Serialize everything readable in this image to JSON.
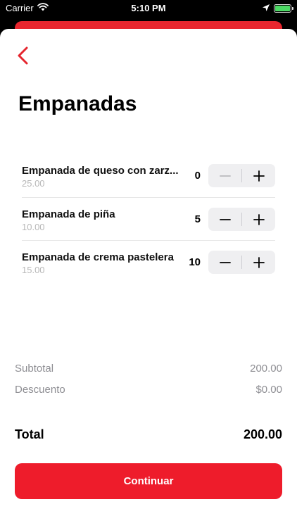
{
  "status_bar": {
    "carrier": "Carrier",
    "time": "5:10 PM",
    "battery_color": "#4cd964"
  },
  "accent_color": "#ee1c2b",
  "header": {
    "back_icon": "chevron-left-icon",
    "title": "Empanadas"
  },
  "items": [
    {
      "name": "Empanada de queso con zarz...",
      "price": "25.00",
      "quantity": "0",
      "minus_enabled": false
    },
    {
      "name": "Empanada de piña",
      "price": "10.00",
      "quantity": "5",
      "minus_enabled": true
    },
    {
      "name": "Empanada de crema pastelera",
      "price": "15.00",
      "quantity": "10",
      "minus_enabled": true
    }
  ],
  "summary": {
    "subtotal_label": "Subtotal",
    "subtotal_value": "200.00",
    "discount_label": "Descuento",
    "discount_value": "$0.00",
    "total_label": "Total",
    "total_value": "200.00"
  },
  "continue_label": "Continuar"
}
